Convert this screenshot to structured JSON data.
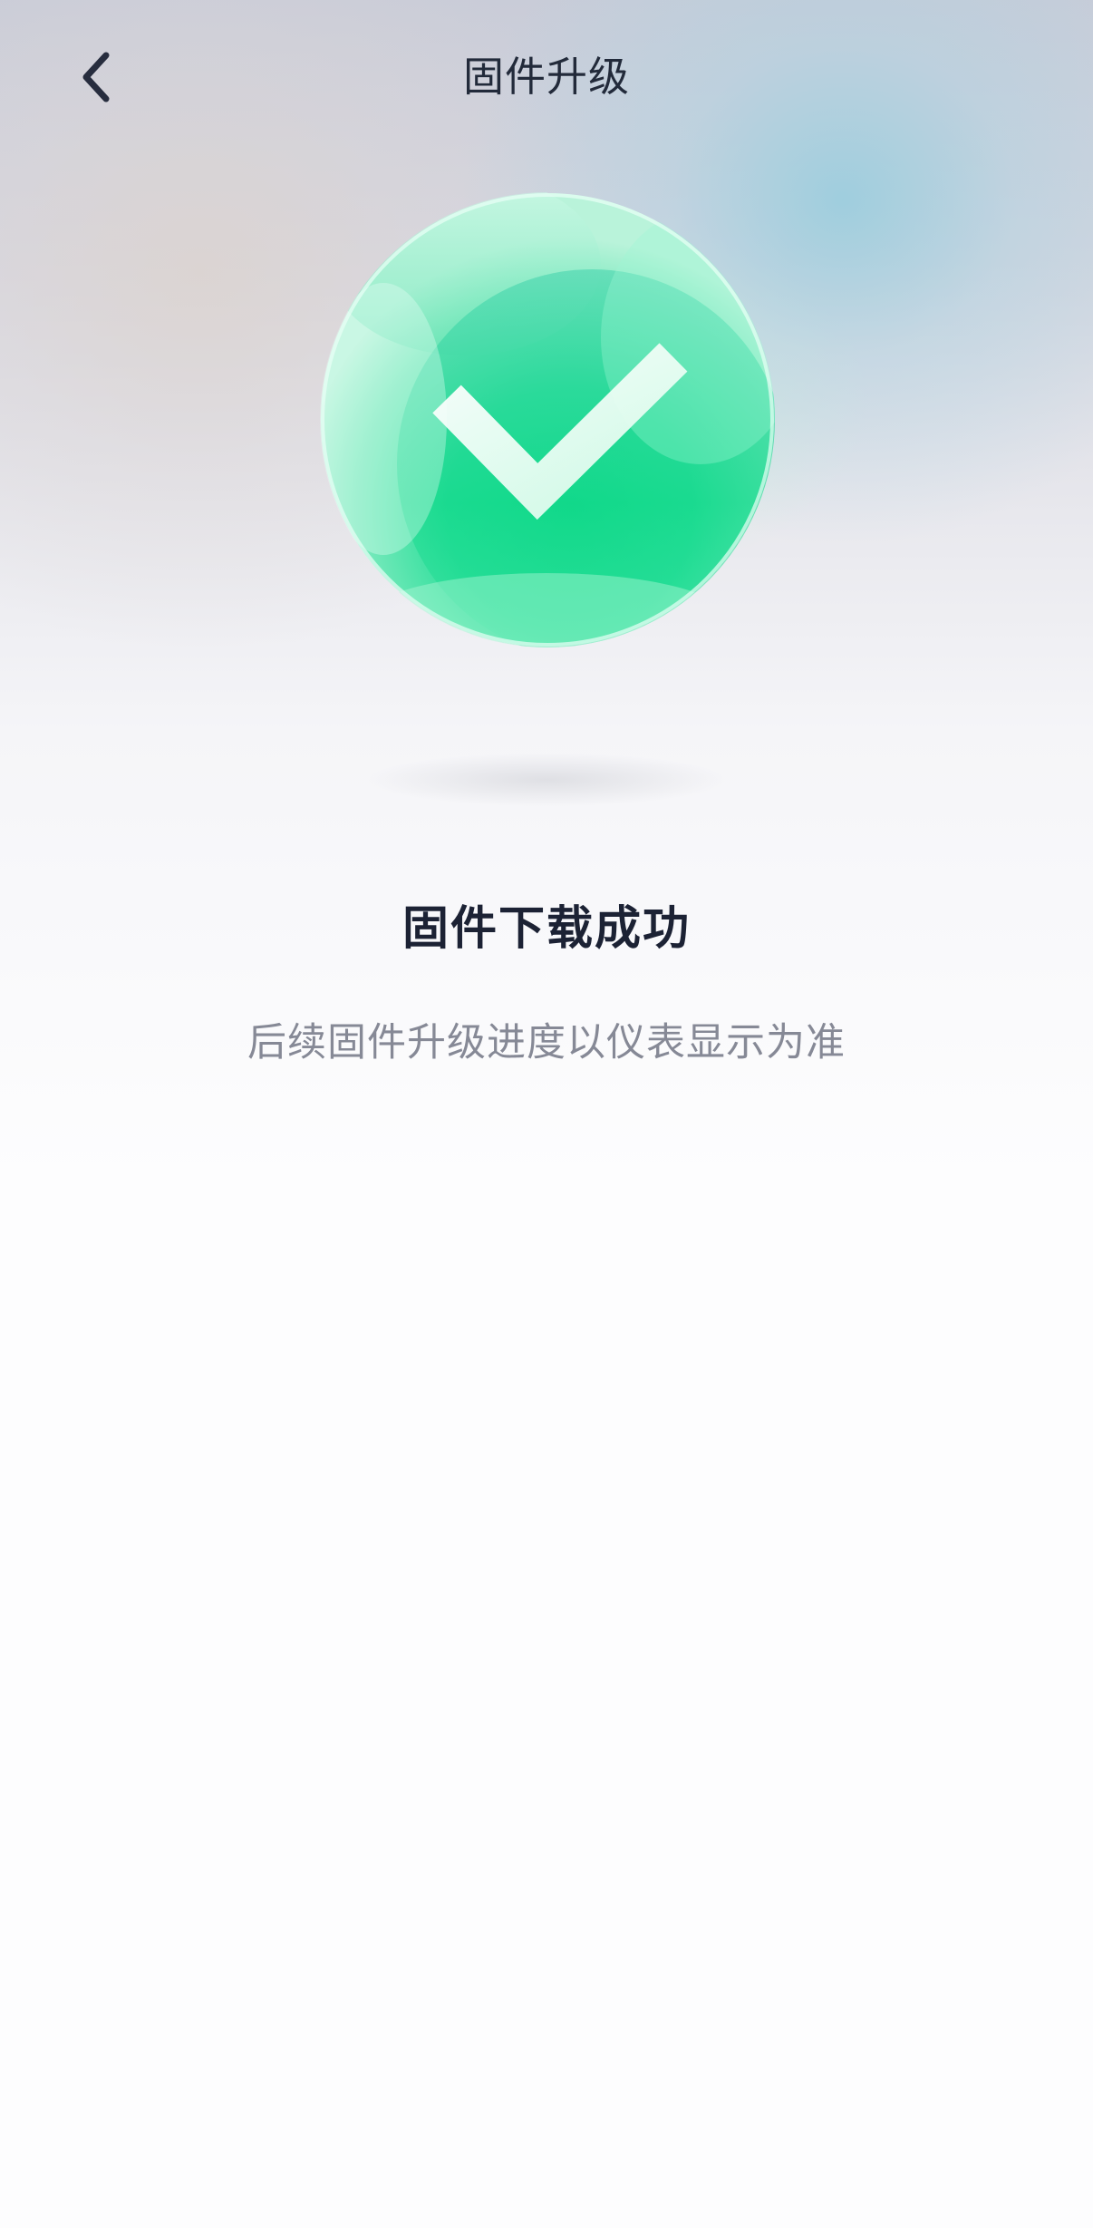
{
  "header": {
    "title": "固件升级",
    "back_icon": "chevron-left-icon"
  },
  "status": {
    "icon": "success-check-icon",
    "headline": "固件下载成功",
    "message": "后续固件升级进度以仪表显示为准",
    "accent_color": "#1fdc8f"
  }
}
